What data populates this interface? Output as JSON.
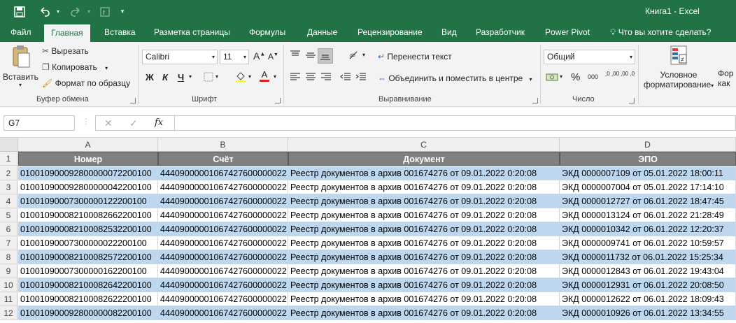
{
  "window": {
    "title": "Книга1  -  Excel"
  },
  "qat": {
    "save_icon": "save-icon",
    "undo_icon": "undo-icon",
    "redo_icon": "redo-icon"
  },
  "tabs": [
    "Файл",
    "Главная",
    "Вставка",
    "Разметка страницы",
    "Формулы",
    "Данные",
    "Рецензирование",
    "Вид",
    "Разработчик",
    "Power Pivot"
  ],
  "tell_me": "Что вы хотите сделать?",
  "ribbon": {
    "clipboard": {
      "paste": "Вставить",
      "cut": "Вырезать",
      "copy": "Копировать",
      "format_painter": "Формат по образцу",
      "group": "Буфер обмена"
    },
    "font": {
      "font_name": "Calibri",
      "font_size": "11",
      "bold": "Ж",
      "italic": "К",
      "underline": "Ч",
      "grow": "A",
      "shrink": "A",
      "font_color_letter": "A",
      "group": "Шрифт"
    },
    "alignment": {
      "wrap": "Перенести текст",
      "merge": "Объединить и поместить в центре",
      "group": "Выравнивание"
    },
    "number": {
      "format": "Общий",
      "percent": "%",
      "comma": "000",
      "inc_decimal": ",0 ,00",
      "dec_decimal": ",00 ,0",
      "group": "Число"
    },
    "styles": {
      "cond_format_1": "Условное",
      "cond_format_2": "форматирование",
      "next_1": "Фор",
      "next_2": "как"
    }
  },
  "formula_bar": {
    "name_box": "G7",
    "fx": "fx",
    "value": ""
  },
  "sheet": {
    "columns": [
      "A",
      "B",
      "C",
      "D"
    ],
    "headers": [
      "Номер",
      "Счёт",
      "Документ",
      "ЭПО"
    ],
    "rows": [
      {
        "n": "2",
        "a": "010010900092800000072200100",
        "b": "44409000001067427600000022",
        "c": "Реестр документов в архив 001674276 от 09.01.2022 0:20:08",
        "d": "ЭКД 0000007109 от 05.01.2022 18:00:11"
      },
      {
        "n": "3",
        "a": "010010900092800000042200100",
        "b": "44409000001067427600000022",
        "c": "Реестр документов в архив 001674276 от 09.01.2022 0:20:08",
        "d": "ЭКД 0000007004 от 05.01.2022 17:14:10"
      },
      {
        "n": "4",
        "a": "01001090007300000122200100",
        "b": "44409000001067427600000022",
        "c": "Реестр документов в архив 001674276 от 09.01.2022 0:20:08",
        "d": "ЭКД 0000012727 от 06.01.2022 18:47:45"
      },
      {
        "n": "5",
        "a": "010010900082100082662200100",
        "b": "44409000001067427600000022",
        "c": "Реестр документов в архив 001674276 от 09.01.2022 0:20:08",
        "d": "ЭКД 0000013124 от 06.01.2022 21:28:49"
      },
      {
        "n": "6",
        "a": "010010900082100082532200100",
        "b": "44409000001067427600000022",
        "c": "Реестр документов в архив 001674276 от 09.01.2022 0:20:08",
        "d": "ЭКД 0000010342 от 06.01.2022 12:20:37"
      },
      {
        "n": "7",
        "a": "01001090007300000022200100",
        "b": "44409000001067427600000022",
        "c": "Реестр документов в архив 001674276 от 09.01.2022 0:20:08",
        "d": "ЭКД 0000009741 от 06.01.2022 10:59:57"
      },
      {
        "n": "8",
        "a": "010010900082100082572200100",
        "b": "44409000001067427600000022",
        "c": "Реестр документов в архив 001674276 от 09.01.2022 0:20:08",
        "d": "ЭКД 0000011732 от 06.01.2022 15:25:34"
      },
      {
        "n": "9",
        "a": "01001090007300000162200100",
        "b": "44409000001067427600000022",
        "c": "Реестр документов в архив 001674276 от 09.01.2022 0:20:08",
        "d": "ЭКД 0000012843 от 06.01.2022 19:43:04"
      },
      {
        "n": "10",
        "a": "010010900082100082642200100",
        "b": "44409000001067427600000022",
        "c": "Реестр документов в архив 001674276 от 09.01.2022 0:20:08",
        "d": "ЭКД 0000012931 от 06.01.2022 20:08:50"
      },
      {
        "n": "11",
        "a": "010010900082100082622200100",
        "b": "44409000001067427600000022",
        "c": "Реестр документов в архив 001674276 от 09.01.2022 0:20:08",
        "d": "ЭКД 0000012622 от 06.01.2022 18:09:43"
      },
      {
        "n": "12",
        "a": "010010900092800000082200100",
        "b": "44409000001067427600000022",
        "c": "Реестр документов в архив 001674276 от 09.01.2022 0:20:08",
        "d": "ЭКД 0000010926 от 06.01.2022 13:34:55"
      }
    ]
  },
  "colors": {
    "excel_green": "#217346",
    "row_highlight": "#bdd7ee",
    "header_fill": "#808080",
    "font_color_red": "#e02020",
    "highlight_yellow": "#ffff00"
  }
}
